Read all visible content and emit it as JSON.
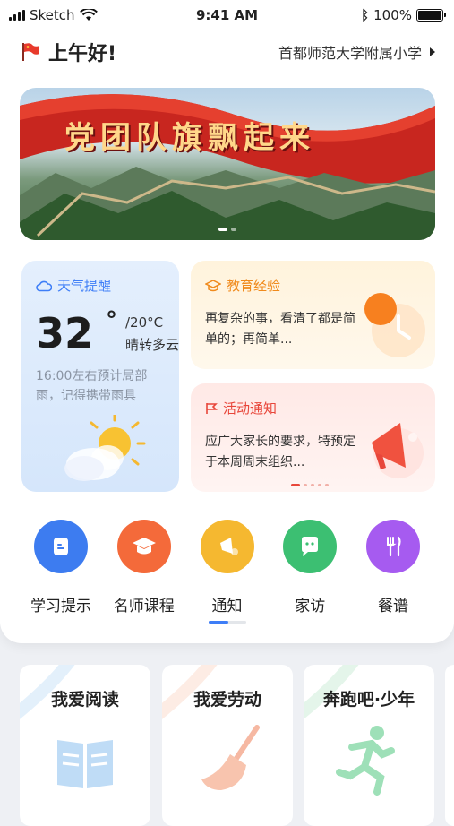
{
  "status": {
    "carrier": "Sketch",
    "time": "9:41 AM",
    "battery": "100%"
  },
  "header": {
    "greeting": "上午好!",
    "school": "首都师范大学附属小学"
  },
  "banner": {
    "title": "党团队旗飘起来"
  },
  "weather": {
    "label": "天气提醒",
    "temp": "32",
    "deg": "°",
    "low": "/20°C",
    "condition": "晴转多云",
    "note": "16:00左右预计局部雨，记得携带雨具"
  },
  "education": {
    "label": "教育经验",
    "text": "再复杂的事，看清了都是简单的；再简单..."
  },
  "activity": {
    "label": "活动通知",
    "text": "应广大家长的要求，特预定于本周周末组织..."
  },
  "shortcuts": [
    {
      "label": "学习提示",
      "color": "#3d7cf0"
    },
    {
      "label": "名师课程",
      "color": "#f46a3a"
    },
    {
      "label": "通知",
      "color": "#f5b830"
    },
    {
      "label": "家访",
      "color": "#3cbf72"
    },
    {
      "label": "餐谱",
      "color": "#a65bf0"
    }
  ],
  "bottom_cards": [
    {
      "title": "我爱阅读"
    },
    {
      "title": "我爱劳动"
    },
    {
      "title": "奔跑吧·少年"
    }
  ],
  "colors": {
    "accent": "#3e7ef7",
    "education": "#f08a1c",
    "activity": "#e8463a",
    "weather": "#3e7ef7"
  }
}
